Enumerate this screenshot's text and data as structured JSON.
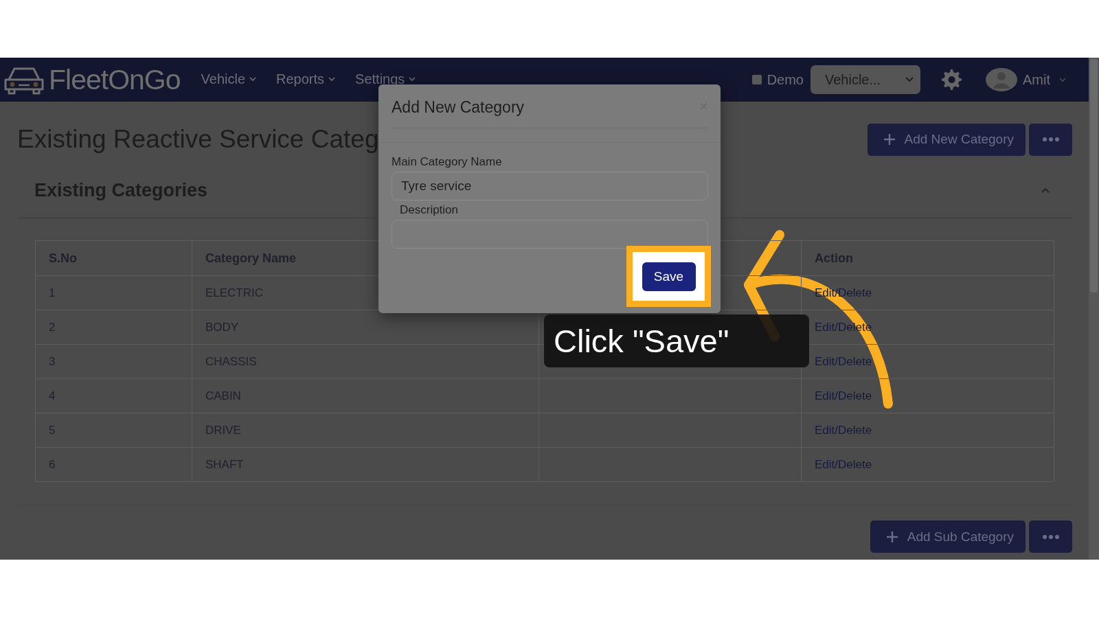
{
  "navbar": {
    "logo": "FleetOnGo",
    "menu": [
      {
        "label": "Vehicle"
      },
      {
        "label": "Reports"
      },
      {
        "label": "Settings"
      }
    ],
    "demo": {
      "label": "Demo",
      "checked": false
    },
    "vehicle_select": {
      "value": "Vehicle..."
    },
    "user": {
      "name": "Amit"
    }
  },
  "page": {
    "title": "Existing Reactive Service Categ",
    "add_button": "Add New Category"
  },
  "card": {
    "title": "Existing Categories",
    "expanded": true,
    "table": {
      "columns": [
        "S.No",
        "Category Name",
        "Action"
      ],
      "rows": [
        {
          "sno": "1",
          "name": "ELECTRIC",
          "action": "Edit/Delete"
        },
        {
          "sno": "2",
          "name": "BODY",
          "action": "Edit/Delete"
        },
        {
          "sno": "3",
          "name": "CHASSIS",
          "action": "Edit/Delete"
        },
        {
          "sno": "4",
          "name": "CABIN",
          "action": "Edit/Delete"
        },
        {
          "sno": "5",
          "name": "DRIVE",
          "action": "Edit/Delete"
        },
        {
          "sno": "6",
          "name": "SHAFT",
          "action": "Edit/Delete"
        }
      ]
    },
    "add_sub_button": "Add Sub Category"
  },
  "modal": {
    "title": "Add New Category",
    "fields": [
      {
        "label": "Main Category Name",
        "value": "Tyre service"
      },
      {
        "label": "Description"
      }
    ],
    "save_button": "Save"
  },
  "callout": {
    "text": "Click \"Save\""
  }
}
